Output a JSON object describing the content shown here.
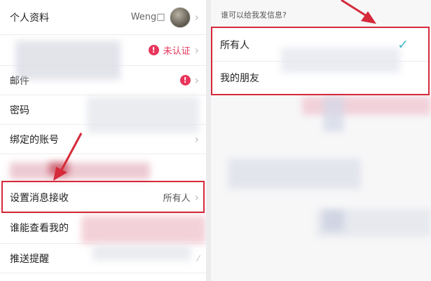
{
  "left": {
    "rows": [
      {
        "label": "个人资料",
        "value": "Weng□"
      },
      {
        "label": "",
        "status": "未认证"
      },
      {
        "label": "邮件"
      },
      {
        "label": "密码"
      },
      {
        "label": "绑定的账号"
      },
      {
        "label": "设置消息接收",
        "value": "所有人"
      },
      {
        "label": "谁能查看我的"
      },
      {
        "label": "推送提醒"
      }
    ],
    "warn_symbol": "!"
  },
  "right": {
    "section_header": "谁可以给我发信息?",
    "options": [
      {
        "label": "所有人",
        "selected": true
      },
      {
        "label": "我的朋友",
        "selected": false
      }
    ],
    "check_symbol": "✓"
  },
  "icons": {
    "chevron": "chevron-right-icon",
    "warning": "warning-icon",
    "check": "checkmark-icon"
  },
  "colors": {
    "accent_red": "#e8355b",
    "highlight_box": "#d62a3a",
    "check_teal": "#3fb6c9"
  }
}
